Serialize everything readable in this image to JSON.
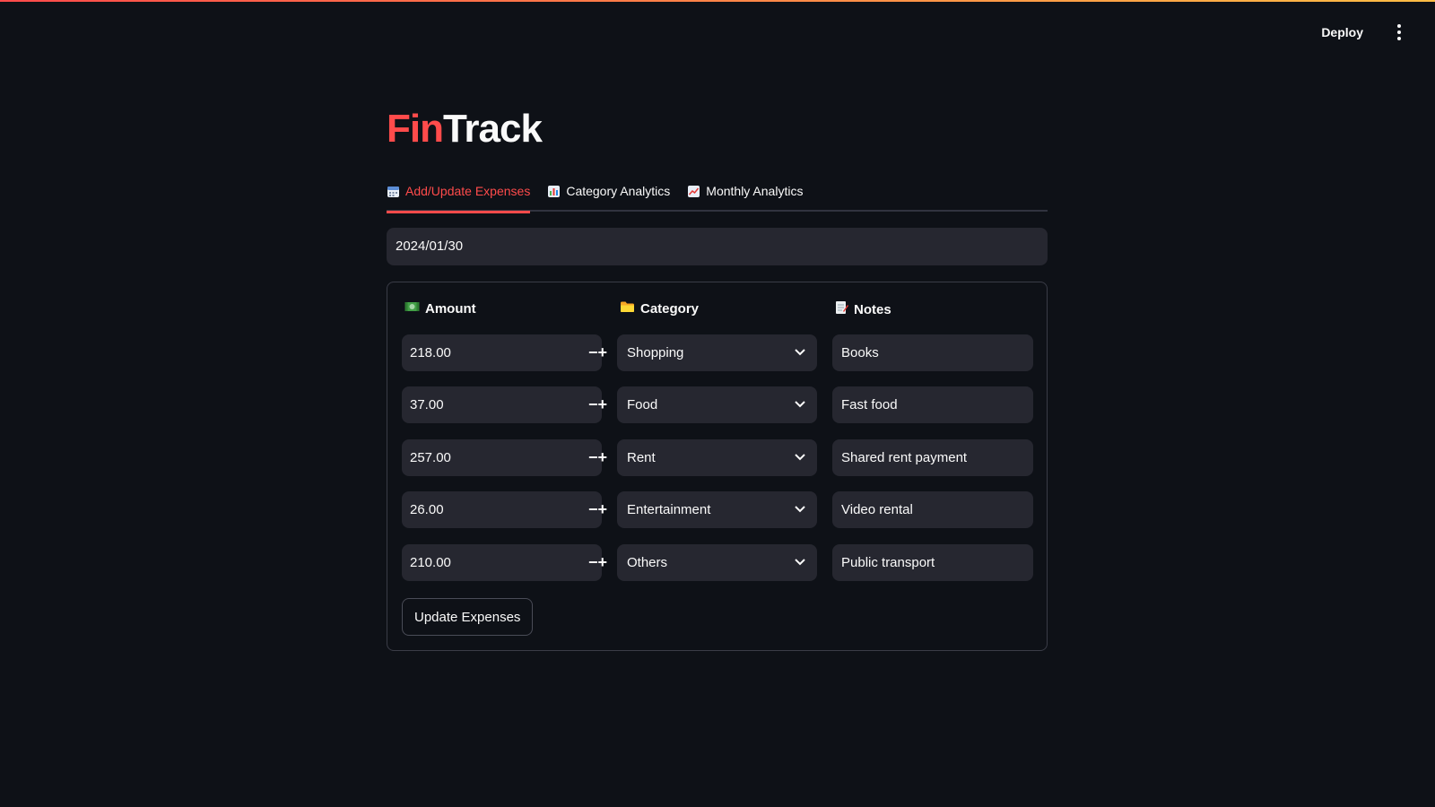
{
  "header": {
    "deploy_label": "Deploy"
  },
  "app": {
    "title_part1": "Fin",
    "title_part2": "Track"
  },
  "tabs": [
    {
      "label": "Add/Update Expenses",
      "icon": "calendar-icon",
      "active": true
    },
    {
      "label": "Category Analytics",
      "icon": "bar-chart-icon",
      "active": false
    },
    {
      "label": "Monthly Analytics",
      "icon": "line-chart-icon",
      "active": false
    }
  ],
  "date_input": {
    "value": "2024/01/30"
  },
  "form": {
    "columns": {
      "amount": {
        "label": "Amount",
        "icon": "money-icon"
      },
      "category": {
        "label": "Category",
        "icon": "folder-icon"
      },
      "notes": {
        "label": "Notes",
        "icon": "memo-icon"
      }
    },
    "rows": [
      {
        "amount": "218.00",
        "category": "Shopping",
        "notes": "Books"
      },
      {
        "amount": "37.00",
        "category": "Food",
        "notes": "Fast food"
      },
      {
        "amount": "257.00",
        "category": "Rent",
        "notes": "Shared rent payment"
      },
      {
        "amount": "26.00",
        "category": "Entertainment",
        "notes": "Video rental"
      },
      {
        "amount": "210.00",
        "category": "Others",
        "notes": "Public transport"
      }
    ],
    "stepper_minus": "−",
    "stepper_plus": "+",
    "submit_label": "Update Expenses"
  },
  "colors": {
    "background": "#0e1117",
    "accent": "#ff4b4b",
    "input_bg": "#262730"
  }
}
